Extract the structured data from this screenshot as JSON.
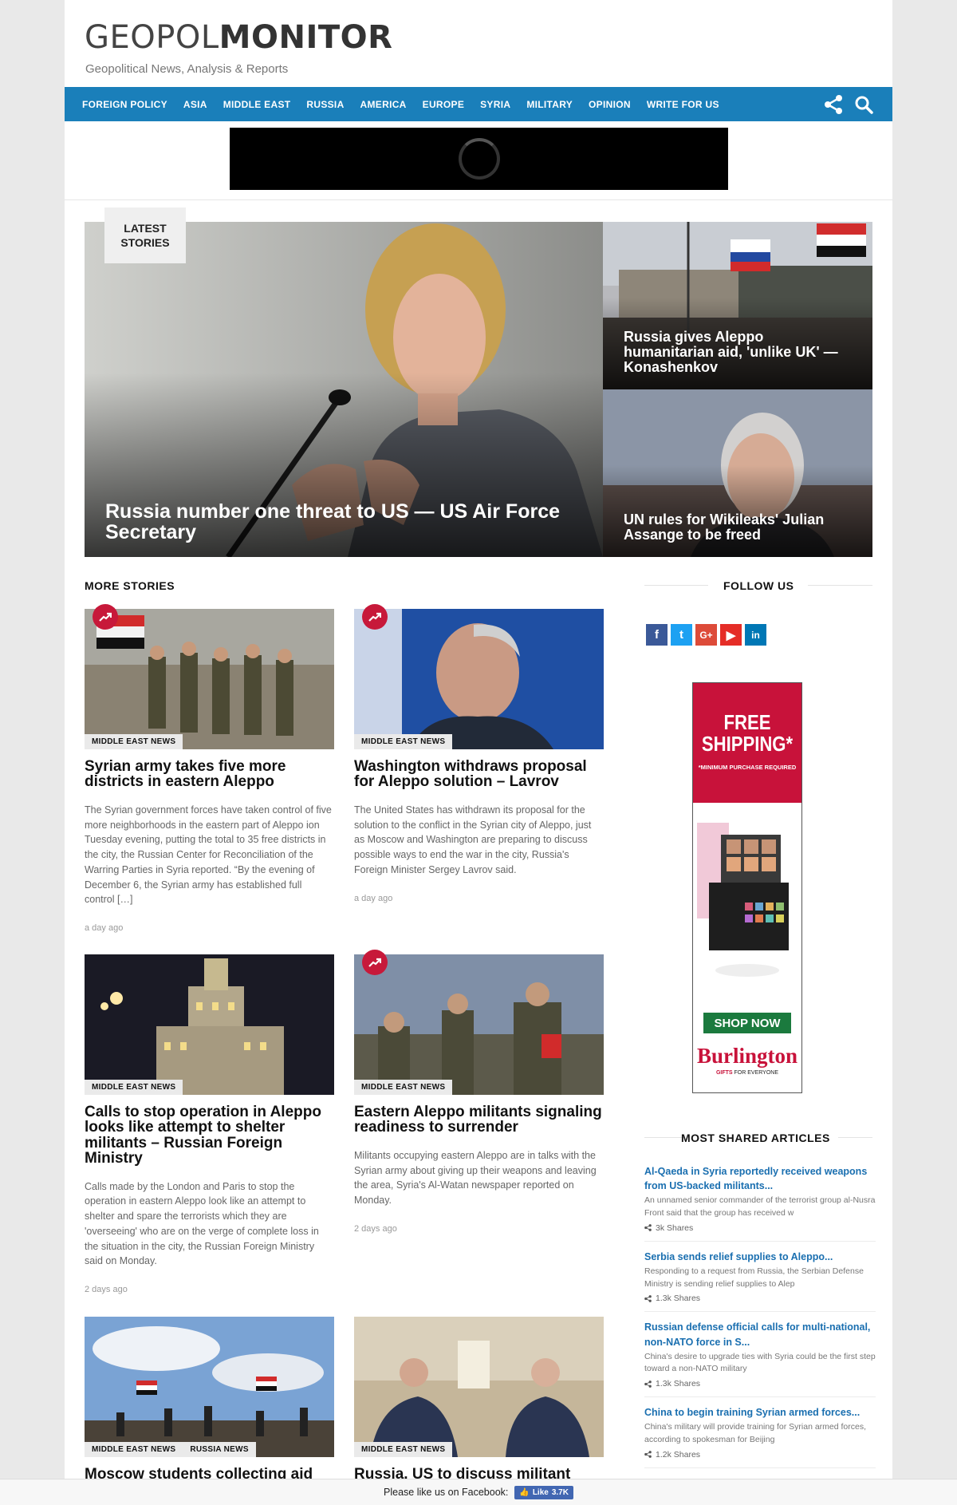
{
  "site": {
    "logo_thin": "GEOPOL",
    "logo_bold": "MONITOR",
    "tagline": "Geopolitical News, Analysis & Reports"
  },
  "nav": {
    "items": [
      "FOREIGN POLICY",
      "ASIA",
      "MIDDLE EAST",
      "RUSSIA",
      "AMERICA",
      "EUROPE",
      "SYRIA",
      "MILITARY",
      "OPINION",
      "WRITE FOR US"
    ],
    "icons": [
      "share-icon",
      "search-icon"
    ],
    "color": "#1a7fba"
  },
  "hero": {
    "badge_line1": "LATEST",
    "badge_line2": "STORIES",
    "main_title": "Russia number one threat to US — US Air Force Secretary",
    "side1_title": "Russia gives Aleppo humanitarian aid, 'unlike UK' — Konashenkov",
    "side2_title": "UN rules for Wikileaks' Julian Assange to be freed"
  },
  "more_stories": {
    "heading": "MORE STORIES",
    "cards": [
      {
        "tags": [
          "MIDDLE EAST NEWS"
        ],
        "title": "Syrian army takes five more districts in eastern Aleppo",
        "excerpt": "The Syrian government forces have taken control of five more neighborhoods in the eastern part of Aleppo ion Tuesday evening, putting the total to 35 free districts in the city, the Russian Center for Reconciliation of the Warring Parties in Syria reported. “By the evening of December 6, the Syrian army has established full control […]",
        "time": "a day ago",
        "trending": true
      },
      {
        "tags": [
          "MIDDLE EAST NEWS"
        ],
        "title": "Washington withdraws proposal for Aleppo solution – Lavrov",
        "excerpt": "The United States has withdrawn its proposal for the solution to the conflict in the Syrian city of Aleppo, just as Moscow and Washington are preparing to discuss possible ways to end the war in the city, Russia's Foreign Minister Sergey Lavrov said.",
        "time": "a day ago",
        "trending": true
      },
      {
        "tags": [
          "MIDDLE EAST NEWS"
        ],
        "title": "Calls to stop operation in Aleppo looks like attempt to shelter militants – Russian Foreign Ministry",
        "excerpt": "Calls made by the London and Paris to stop the operation in eastern Aleppo look like an attempt to shelter and spare the terrorists which they are 'overseeing' who are on the verge of complete loss in the situation in the city, the Russian Foreign Ministry said on Monday.",
        "time": "2 days ago",
        "trending": false
      },
      {
        "tags": [
          "MIDDLE EAST NEWS"
        ],
        "title": "Eastern Aleppo militants signaling readiness to surrender",
        "excerpt": "Militants occupying eastern Aleppo are in talks with the Syrian army about giving up their weapons and leaving the area, Syria's Al-Watan newspaper reported on Monday.",
        "time": "2 days ago",
        "trending": true
      },
      {
        "tags": [
          "MIDDLE EAST NEWS",
          "RUSSIA NEWS"
        ],
        "title": "Moscow students collecting aid for",
        "excerpt": "",
        "time": "",
        "trending": false
      },
      {
        "tags": [
          "MIDDLE EAST NEWS"
        ],
        "title": "Russia, US to discuss militant",
        "excerpt": "",
        "time": "",
        "trending": false
      }
    ]
  },
  "sidebar": {
    "follow_heading": "FOLLOW US",
    "social": [
      {
        "name": "facebook-icon",
        "glyph": "f",
        "color": "#3b5998"
      },
      {
        "name": "twitter-icon",
        "glyph": "t",
        "color": "#1da1f2"
      },
      {
        "name": "google-plus-icon",
        "glyph": "G+",
        "color": "#dd4b39"
      },
      {
        "name": "youtube-icon",
        "glyph": "▶",
        "color": "#e52d27"
      },
      {
        "name": "linkedin-icon",
        "glyph": "in",
        "color": "#0077b5"
      }
    ],
    "ad": {
      "free": "FREE",
      "shipping": "SHIPPING*",
      "min": "*MINIMUM PURCHASE REQUIRED",
      "shop_now": "SHOP NOW",
      "brand": "Burlington",
      "sub_prefix": "GIFTS",
      "sub_rest": " FOR EVERYONE"
    },
    "shared_heading": "MOST SHARED ARTICLES",
    "shared": [
      {
        "title": "Al-Qaeda in Syria reportedly received weapons from US-backed militants...",
        "desc": "An unnamed senior commander of the terrorist group al-Nusra Front said that the group has received w",
        "shares": "3k Shares"
      },
      {
        "title": "Serbia sends relief supplies to Aleppo...",
        "desc": "Responding to a request from Russia, the Serbian Defense Ministry is sending relief supplies to Alep",
        "shares": "1.3k Shares"
      },
      {
        "title": "Russian defense official calls for multi-national, non-NATO force in S...",
        "desc": "China's desire to upgrade ties with Syria could be the first step toward a non-NATO military",
        "shares": "1.3k Shares"
      },
      {
        "title": "China to begin training Syrian armed forces...",
        "desc": "China's military will provide training for Syrian armed forces, according to spokesman for Beijing",
        "shares": "1.2k Shares"
      }
    ]
  },
  "footer": {
    "prompt": "Please like us on Facebook:",
    "like_label": "Like",
    "like_count": "3.7K"
  }
}
